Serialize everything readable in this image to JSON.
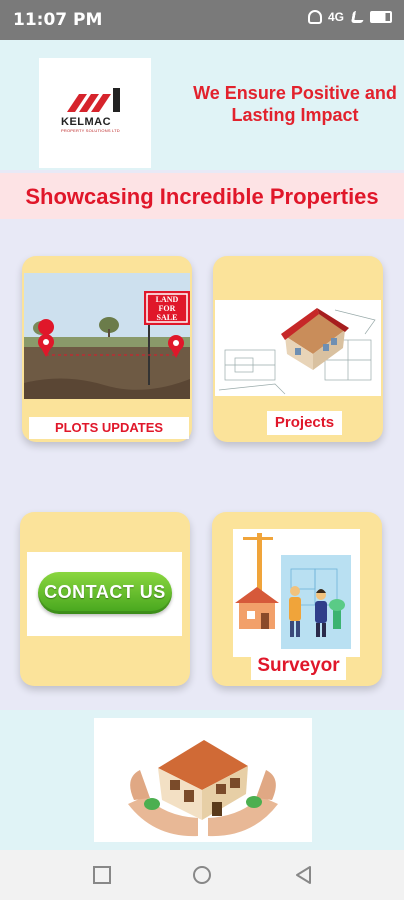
{
  "status_bar": {
    "time": "11:07 PM",
    "icons": [
      "mute-icon",
      "data-arrows-icon",
      "network-icon",
      "signal-icon",
      "voice-icon",
      "battery-icon"
    ],
    "network_text": "4G"
  },
  "header": {
    "logo_text": "KELMAC",
    "logo_subtext": "PROPERTY SOLUTIONS LTD",
    "tagline_line1": "We Ensure Positive and",
    "tagline_line2": "Lasting Impact"
  },
  "banner": {
    "title": "Showcasing Incredible Properties"
  },
  "cards": {
    "plots": {
      "label": "PLOTS UPDATES",
      "sign_line1": "LAND",
      "sign_line2": "FOR",
      "sign_line3": "SALE"
    },
    "projects": {
      "label": "Projects"
    },
    "contact": {
      "button_text": "CONTACT US"
    },
    "surveyor": {
      "label": "Surveyor"
    }
  },
  "nav": {
    "buttons": [
      "recents-button",
      "home-button",
      "back-button"
    ]
  },
  "colors": {
    "brand_red": "#e0172a",
    "card_yellow": "#fbe39a",
    "header_bg": "#e0f3f6",
    "banner_bg": "#fde3e5",
    "contact_green": "#5fbf2f"
  }
}
